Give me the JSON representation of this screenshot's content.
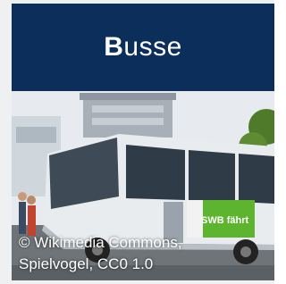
{
  "card": {
    "title_first_letter": "B",
    "title_rest": "usse",
    "photo_credit_line1": "© Wikimedia Commons,",
    "photo_credit_line2": "Spielvogel, CC0 1.0"
  },
  "bus": {
    "ad_text": "SWB fährt"
  },
  "colors": {
    "header_bg": "#0b2f5a",
    "bus_body": "#e9ecef",
    "ad_green": "#5db52f"
  }
}
